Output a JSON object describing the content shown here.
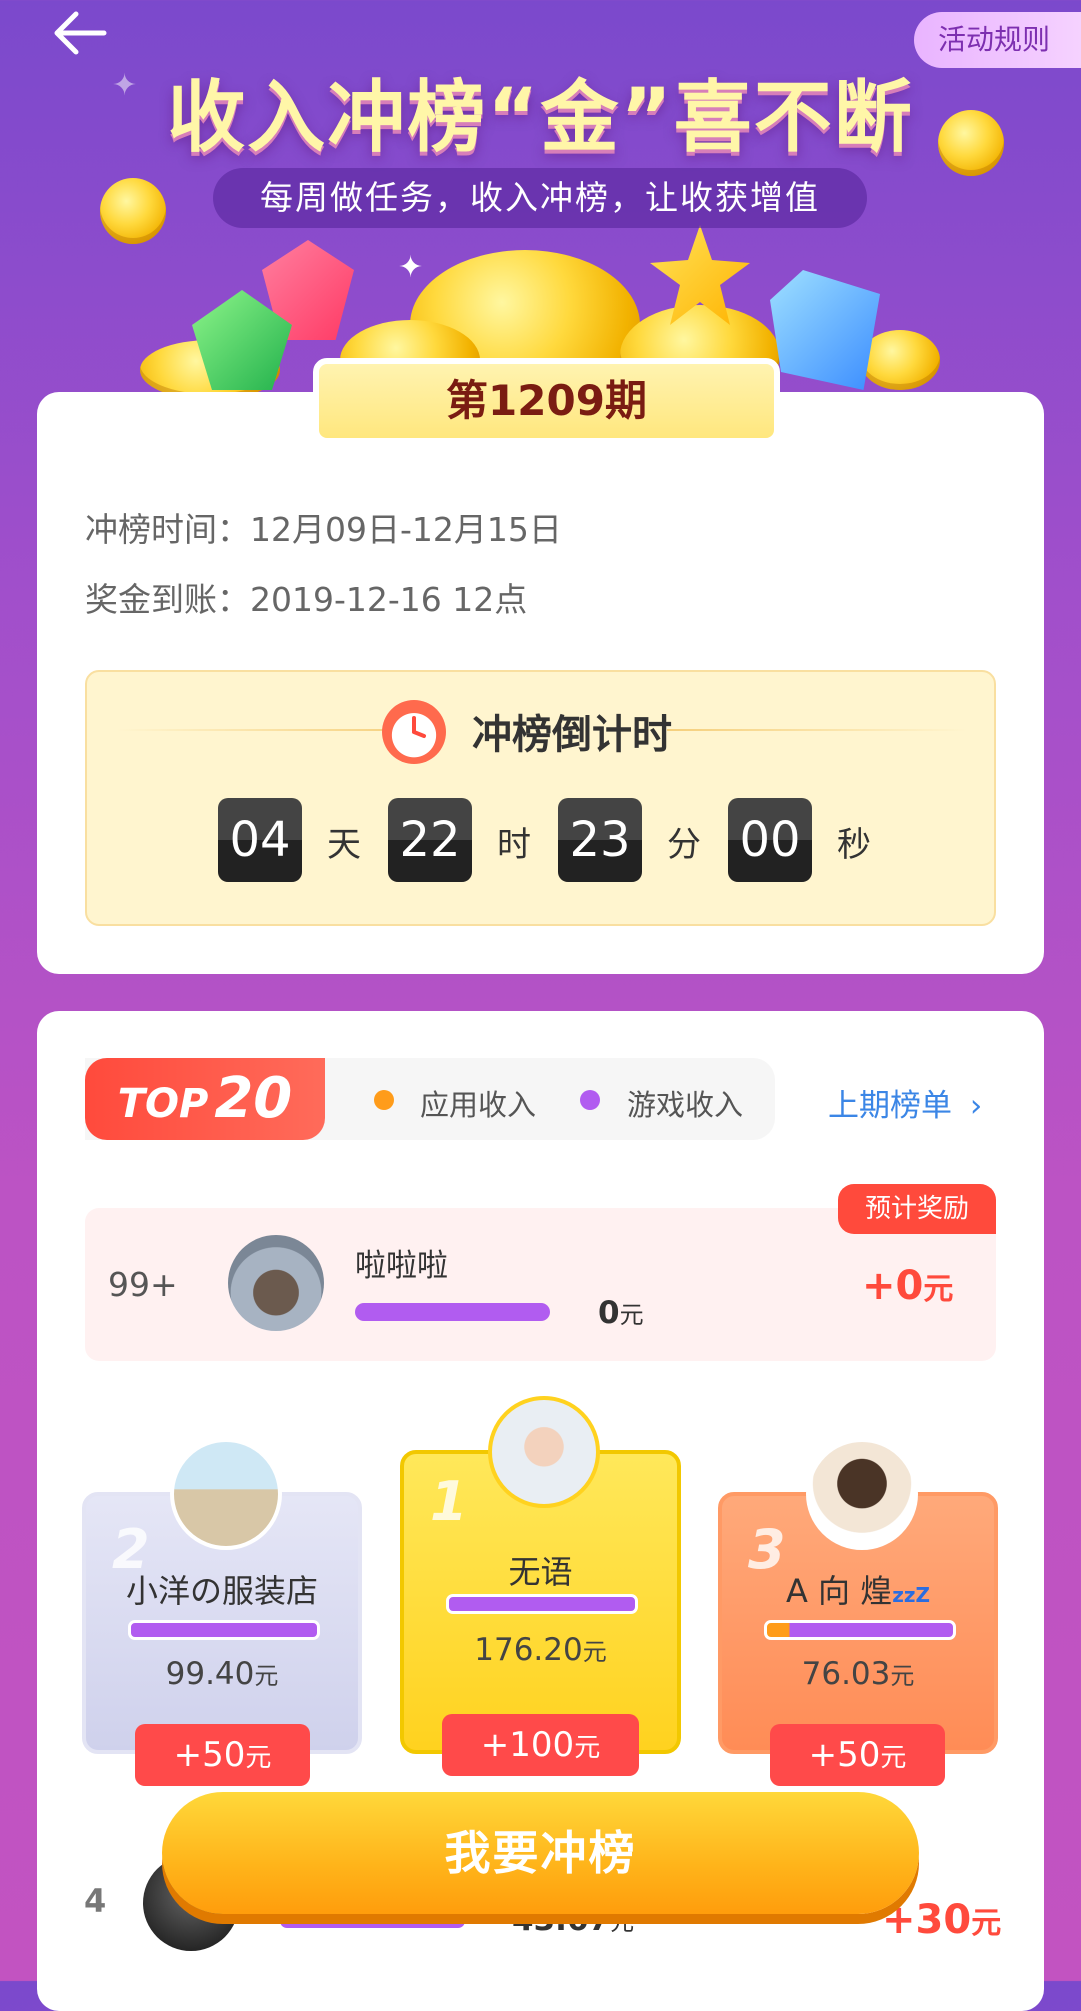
{
  "header": {
    "back_icon": "arrow-left-icon",
    "rules_label": "活动规则",
    "hero_title": "收入冲榜“金”喜不断",
    "hero_subtitle": "每周做任务，收入冲榜，让收获增值"
  },
  "period": {
    "badge": "第1209期",
    "rank_time_label": "冲榜时间：",
    "rank_time_value": "12月09日-12月15日",
    "payout_label": "奖金到账：",
    "payout_value": "2019-12-16 12点"
  },
  "countdown": {
    "title": "冲榜倒计时",
    "icon": "alarm-clock-icon",
    "days": "04",
    "days_unit": "天",
    "hours": "22",
    "hours_unit": "时",
    "minutes": "23",
    "minutes_unit": "分",
    "seconds": "00",
    "seconds_unit": "秒"
  },
  "ranking": {
    "badge_top": "TOP",
    "badge_num": "20",
    "legend_app": "应用收入",
    "legend_game": "游戏收入",
    "legend_app_color": "#ff9c1a",
    "legend_game_color": "#b15cf0",
    "prev_link": "上期榜单",
    "my_row": {
      "rank": "99+",
      "name": "啦啦啦",
      "amount": "0",
      "amount_unit": "元",
      "reward_badge": "预计奖励",
      "reward": "+0",
      "reward_unit": "元"
    },
    "podium": [
      {
        "rank": "2",
        "name": "小洋の服装店",
        "amount": "99.40",
        "unit": "元",
        "reward": "+50",
        "reward_unit": "元"
      },
      {
        "rank": "1",
        "name": "无语",
        "amount": "176.20",
        "unit": "元",
        "reward": "+100",
        "reward_unit": "元"
      },
      {
        "rank": "3",
        "name": "A 向 煌",
        "amount": "76.03",
        "unit": "元",
        "reward": "+50",
        "reward_unit": "元",
        "suffix": "zzZ"
      }
    ],
    "fourth": {
      "rank": "4",
      "amount": "43.67",
      "unit": "元",
      "reward": "+30",
      "reward_unit": "元"
    }
  },
  "cta": {
    "label": "我要冲榜"
  }
}
